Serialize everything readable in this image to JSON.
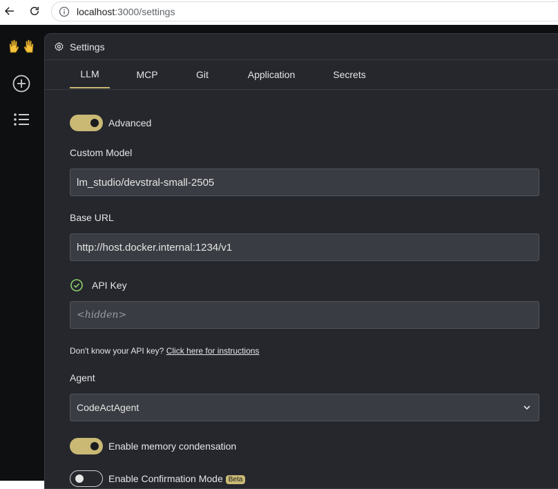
{
  "browser": {
    "url_host": "localhost",
    "url_rest": ":3000/settings"
  },
  "sidebar": {
    "logo": "🙌",
    "items": [
      {
        "name": "new-conversation-icon"
      },
      {
        "name": "list-icon"
      }
    ]
  },
  "panel": {
    "title": "Settings",
    "tabs": [
      {
        "label": "LLM",
        "active": true
      },
      {
        "label": "MCP",
        "active": false
      },
      {
        "label": "Git",
        "active": false
      },
      {
        "label": "Application",
        "active": false
      },
      {
        "label": "Secrets",
        "active": false
      }
    ]
  },
  "form": {
    "advanced_label": "Advanced",
    "advanced_on": true,
    "custom_model_label": "Custom Model",
    "custom_model_value": "lm_studio/devstral-small-2505",
    "base_url_label": "Base URL",
    "base_url_value": "http://host.docker.internal:1234/v1",
    "api_key_label": "API Key",
    "api_key_placeholder": "<hidden>",
    "hint_text": "Don't know your API key?",
    "hint_link": "Click here for instructions",
    "agent_label": "Agent",
    "agent_value": "CodeActAgent",
    "memory_label": "Enable memory condensation",
    "memory_on": true,
    "confirmation_label": "Enable Confirmation Mode",
    "confirmation_badge": "Beta",
    "confirmation_on": false
  },
  "colors": {
    "accent": "#c9b974",
    "panel_bg": "#25272d",
    "field_bg": "#3a3c43",
    "check": "#8fd46c"
  }
}
